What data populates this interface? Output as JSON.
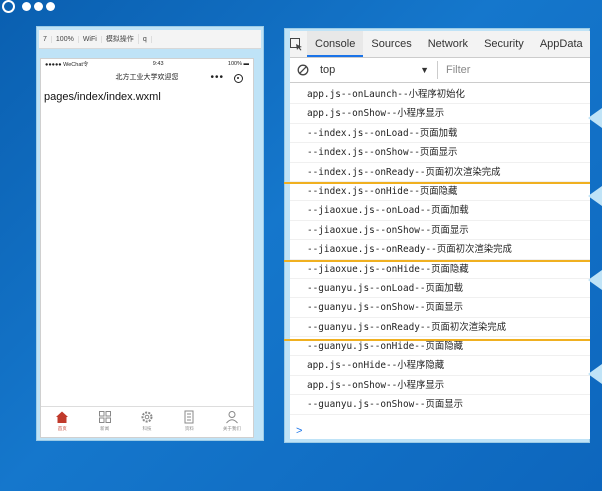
{
  "simulator": {
    "toolbar": [
      "7",
      "100%",
      "WiFi",
      "模拟操作",
      "q"
    ],
    "status": {
      "carrier": "●●●●● WeChat令",
      "time": "9:43",
      "battery": "100% ▬"
    },
    "nav_title": "北方工业大学欢迎您",
    "page_path": "pages/index/index.wxml",
    "tabs": [
      {
        "label": "首页",
        "icon": "home-icon"
      },
      {
        "label": "新闻",
        "icon": "grid-icon"
      },
      {
        "label": "科技",
        "icon": "gear-icon"
      },
      {
        "label": "资料",
        "icon": "document-icon"
      },
      {
        "label": "关于我们",
        "icon": "user-icon"
      }
    ],
    "active_tab": 0
  },
  "devtools": {
    "tabs": [
      "Console",
      "Sources",
      "Network",
      "Security",
      "AppData"
    ],
    "active_tab": "Console",
    "context": "top",
    "filter_placeholder": "Filter",
    "logs": [
      "app.js--onLaunch--小程序初始化",
      "app.js--onShow--小程序显示",
      "--index.js--onLoad--页面加载",
      "--index.js--onShow--页面显示",
      "--index.js--onReady--页面初次渲染完成",
      "--index.js--onHide--页面隐藏",
      "--jiaoxue.js--onLoad--页面加载",
      "--jiaoxue.js--onShow--页面显示",
      "--jiaoxue.js--onReady--页面初次渲染完成",
      "--jiaoxue.js--onHide--页面隐藏",
      "--guanyu.js--onLoad--页面加载",
      "--guanyu.js--onShow--页面显示",
      "--guanyu.js--onReady--页面初次渲染完成",
      "--guanyu.js--onHide--页面隐藏",
      "app.js--onHide--小程序隐藏",
      "app.js--onShow--小程序显示",
      "--guanyu.js--onShow--页面显示"
    ],
    "prompt": ">"
  },
  "colors": {
    "background": "#0d66bd",
    "divider": "#f0b020",
    "active_tab": "#c0392b",
    "accent": "#1a73e8"
  }
}
